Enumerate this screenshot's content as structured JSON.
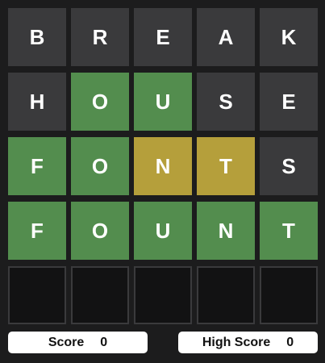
{
  "board": {
    "rows": [
      {
        "letters": [
          "B",
          "R",
          "E",
          "A",
          "K"
        ],
        "states": [
          "absent",
          "absent",
          "absent",
          "absent",
          "absent"
        ]
      },
      {
        "letters": [
          "H",
          "O",
          "U",
          "S",
          "E"
        ],
        "states": [
          "absent",
          "correct",
          "correct",
          "absent",
          "absent"
        ]
      },
      {
        "letters": [
          "F",
          "O",
          "N",
          "T",
          "S"
        ],
        "states": [
          "correct",
          "correct",
          "present",
          "present",
          "absent"
        ]
      },
      {
        "letters": [
          "F",
          "O",
          "U",
          "N",
          "T"
        ],
        "states": [
          "correct",
          "correct",
          "correct",
          "correct",
          "correct"
        ]
      },
      {
        "letters": [
          "",
          "",
          "",
          "",
          ""
        ],
        "states": [
          "empty",
          "empty",
          "empty",
          "empty",
          "empty"
        ]
      }
    ]
  },
  "score": {
    "label": "Score",
    "value": "0"
  },
  "high_score": {
    "label": "High Score",
    "value": "0"
  },
  "colors": {
    "background": "#1c1c1d",
    "absent": "#3a3a3c",
    "correct": "#538d4e",
    "present": "#b59f3b",
    "empty": "#121213"
  }
}
